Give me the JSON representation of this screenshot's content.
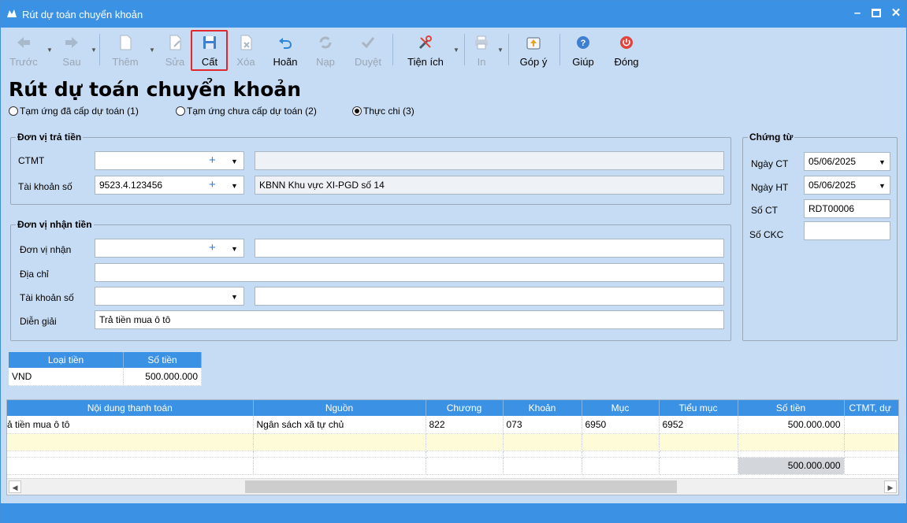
{
  "window": {
    "title": "Rút dự toán chuyển khoản"
  },
  "toolbar": {
    "prev": "Trước",
    "next": "Sau",
    "add": "Thêm",
    "edit": "Sửa",
    "save": "Cất",
    "delete": "Xóa",
    "undo": "Hoãn",
    "load": "Nạp",
    "approve": "Duyệt",
    "utilities": "Tiện ích",
    "print": "In",
    "feedback": "Góp ý",
    "help": "Giúp",
    "close": "Đóng"
  },
  "page": {
    "title": "Rút dự toán chuyển khoản"
  },
  "options": {
    "opt1": "Tạm ứng đã cấp dự toán (1)",
    "opt2": "Tạm ứng chưa cấp dự toán (2)",
    "opt3": "Thực chi (3)",
    "selected": "opt3"
  },
  "payer": {
    "legend": "Đơn vị trả tiền",
    "ctmt_label": "CTMT",
    "ctmt_value": "",
    "ctmt_desc": "",
    "account_label": "Tài khoản số",
    "account_value": "9523.4.123456",
    "account_desc": "KBNN Khu vực XI-PGD số 14"
  },
  "receiver": {
    "legend": "Đơn vị nhận tiền",
    "unit_label": "Đơn vị nhận",
    "unit_value": "",
    "unit_desc": "",
    "address_label": "Địa chỉ",
    "address_value": "",
    "account_label": "Tài khoản số",
    "account_value": "",
    "account_desc": "",
    "desc_label": "Diễn giải",
    "desc_value": "Trả tiền mua ô tô"
  },
  "voucher": {
    "legend": "Chứng từ",
    "date_ct_label": "Ngày CT",
    "date_ct": "05/06/2025",
    "date_ht_label": "Ngày HT",
    "date_ht": "05/06/2025",
    "no_ct_label": "Số CT",
    "no_ct": "RDT00006",
    "no_ckc_label": "Số CKC",
    "no_ckc": ""
  },
  "currency_table": {
    "headers": [
      "Loại tiền",
      "Số tiền"
    ],
    "row": [
      "VND",
      "500.000.000"
    ]
  },
  "detail_table": {
    "headers": [
      "Nội dung thanh toán",
      "Nguồn",
      "Chương",
      "Khoản",
      "Mục",
      "Tiểu mục",
      "Số tiền",
      "CTMT, dự"
    ],
    "rows": [
      [
        "ả tiền mua ô tô",
        "Ngân sách xã  tự chủ",
        "822",
        "073",
        "6950",
        "6952",
        "500.000.000",
        ""
      ]
    ],
    "total": "500.000.000"
  },
  "colors": {
    "accent": "#3b92e4",
    "background": "#c6dcf4",
    "highlight": "#e0282e"
  }
}
